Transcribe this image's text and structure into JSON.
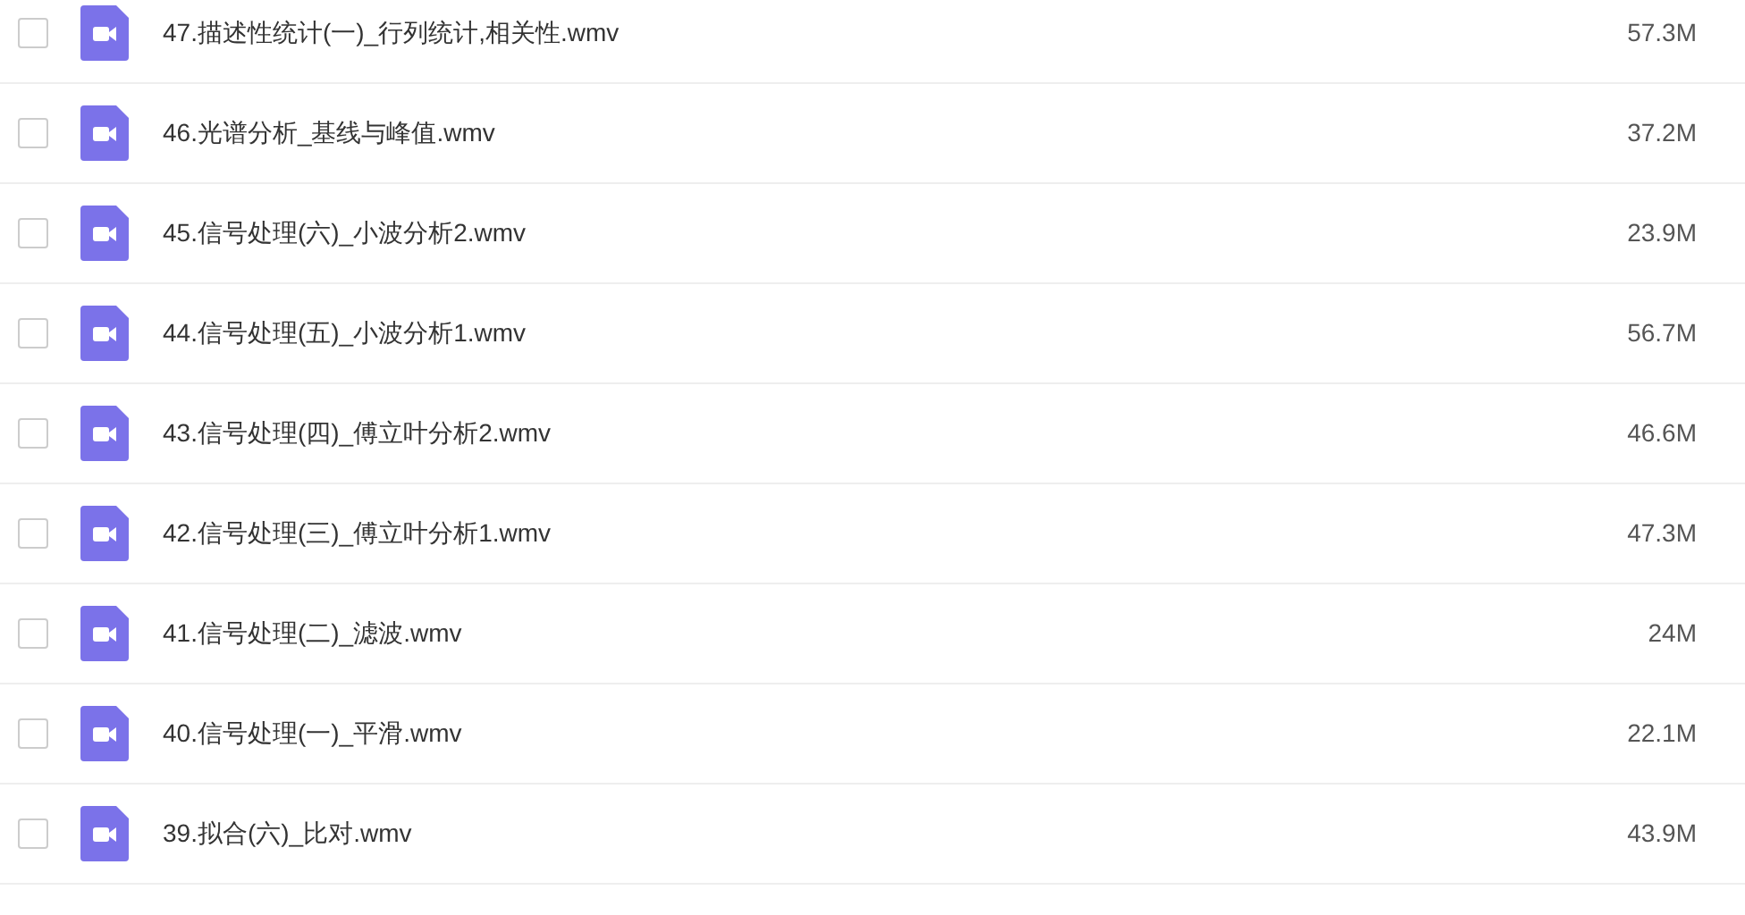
{
  "files": [
    {
      "name": "47.描述性统计(一)_行列统计,相关性.wmv",
      "size": "57.3M",
      "checked": false
    },
    {
      "name": "46.光谱分析_基线与峰值.wmv",
      "size": "37.2M",
      "checked": false
    },
    {
      "name": "45.信号处理(六)_小波分析2.wmv",
      "size": "23.9M",
      "checked": false
    },
    {
      "name": "44.信号处理(五)_小波分析1.wmv",
      "size": "56.7M",
      "checked": false
    },
    {
      "name": "43.信号处理(四)_傅立叶分析2.wmv",
      "size": "46.6M",
      "checked": false
    },
    {
      "name": "42.信号处理(三)_傅立叶分析1.wmv",
      "size": "47.3M",
      "checked": false
    },
    {
      "name": "41.信号处理(二)_滤波.wmv",
      "size": "24M",
      "checked": false
    },
    {
      "name": "40.信号处理(一)_平滑.wmv",
      "size": "22.1M",
      "checked": false
    },
    {
      "name": "39.拟合(六)_比对.wmv",
      "size": "43.9M",
      "checked": false
    }
  ]
}
